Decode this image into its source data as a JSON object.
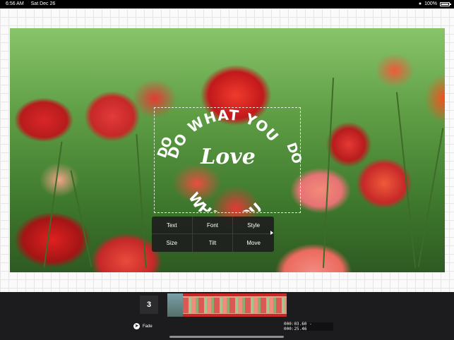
{
  "status_bar": {
    "time": "6:56 AM",
    "date": "Sat Dec 26",
    "battery": "100%"
  },
  "overlay": {
    "arc_top": "DO WHAT YOU",
    "arc_left_mirror": "DO",
    "arc_bottom": "WHAT YOU",
    "arc_right": "DO",
    "script_word": "Love"
  },
  "context_menu": {
    "items": [
      "Text",
      "Font",
      "Style",
      "Size",
      "Tilt",
      "Move"
    ]
  },
  "timeline": {
    "clip_count": "3"
  },
  "bottom_bar": {
    "fade_label": "Fade",
    "time_range": "000:03.60 - 000:25.46"
  },
  "colors": {
    "menu_bg": "#1e1e1e",
    "toolbar_bg": "#1c1c1e",
    "clip_accent": "#c62828"
  }
}
